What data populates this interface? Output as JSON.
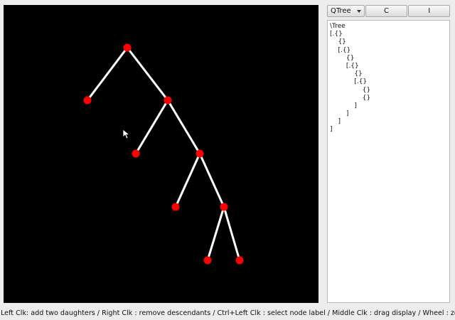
{
  "toolbar": {
    "format_select_value": "QTree",
    "c_label": "C",
    "i_label": "I"
  },
  "code_lines": [
    "\\Tree",
    "[.{}",
    "    {}",
    "    [.{}",
    "        {}",
    "        [.{}",
    "            {}",
    "            [.{}",
    "                {}",
    "                {}",
    "            ]",
    "        ]",
    "    ]",
    "]"
  ],
  "status_text": "Left Clk: add two daughters / Right Clk : remove descendants / Ctrl+Left Clk : select node label / Middle Clk : drag display / Wheel : zoom",
  "tree": {
    "nodes": [
      {
        "id": "root",
        "parent": null
      },
      {
        "id": "n1",
        "parent": "root"
      },
      {
        "id": "n2",
        "parent": "root"
      },
      {
        "id": "n3",
        "parent": "n2"
      },
      {
        "id": "n4",
        "parent": "n2"
      },
      {
        "id": "n5",
        "parent": "n4"
      },
      {
        "id": "n6",
        "parent": "n4"
      },
      {
        "id": "n7",
        "parent": "n6"
      },
      {
        "id": "n8",
        "parent": "n6"
      }
    ],
    "edge_color": "#ffffff",
    "node_color": "#ff0000",
    "background": "#000000"
  }
}
